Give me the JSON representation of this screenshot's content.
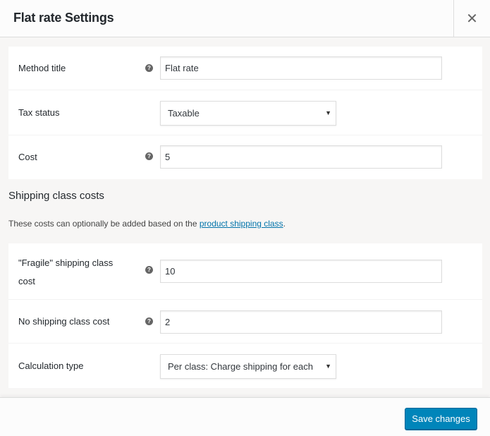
{
  "modal": {
    "title": "Flat rate Settings",
    "close_icon": "close-icon",
    "close_glyph": "✕"
  },
  "general_fields": [
    {
      "label": "Method title",
      "type": "text",
      "value": "Flat rate",
      "has_help": true
    },
    {
      "label": "Tax status",
      "type": "select",
      "value": "Taxable",
      "has_help": false
    },
    {
      "label": "Cost",
      "type": "text",
      "value": "5",
      "has_help": true
    }
  ],
  "shipping_class_section": {
    "title": "Shipping class costs",
    "description_prefix": "These costs can optionally be added based on the ",
    "link_text": "product shipping class",
    "description_suffix": "."
  },
  "class_fields": [
    {
      "label_line1": "\"Fragile\" shipping class",
      "label_line2": "cost",
      "type": "text",
      "value": "10",
      "has_help": true
    },
    {
      "label": "No shipping class cost",
      "type": "text",
      "value": "2",
      "has_help": true
    },
    {
      "label": "Calculation type",
      "type": "select",
      "value": "Per class: Charge shipping for each",
      "has_help": false
    }
  ],
  "help_glyph": "?",
  "select_arrow": "▼",
  "footer": {
    "save_label": "Save changes"
  },
  "colors": {
    "primary_button": "#0085ba",
    "link": "#0073aa",
    "body_bg": "#f7f6f5"
  }
}
